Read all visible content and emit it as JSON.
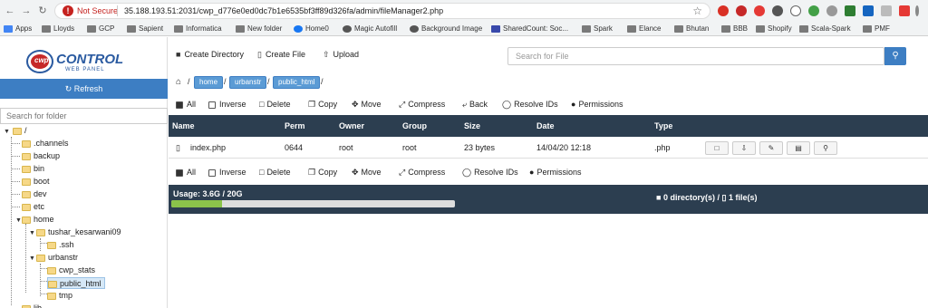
{
  "browser": {
    "security_label": "Not Secure",
    "url": "35.188.193.51:2031/cwp_d776e0ed0dc7b1e6535bf3ff89d326fa/admin/fileManager2.php",
    "bookmarks": [
      "Apps",
      "Lloyds",
      "GCP",
      "Sapient",
      "Informatica",
      "New folder",
      "Home0",
      "Magic Autofill",
      "Background Image",
      "SharedCount: Soc...",
      "Spark",
      "Elance",
      "Bhutan",
      "BBB",
      "Shopify",
      "Scala-Spark",
      "PMF"
    ]
  },
  "sidebar": {
    "logo_main": "CONTROL",
    "logo_sub": "WEB PANEL",
    "logo_prefix": "cwp",
    "refresh_label": "Refresh",
    "search_placeholder": "Search for folder",
    "tree": {
      "root": "/",
      "channels": ".channels",
      "backup": "backup",
      "bin": "bin",
      "boot": "boot",
      "dev": "dev",
      "etc": "etc",
      "home": "home",
      "tushar": "tushar_kesarwani09",
      "ssh": ".ssh",
      "urbanstr": "urbanstr",
      "cwp_stats": "cwp_stats",
      "public_html": "public_html",
      "tmp": "tmp",
      "lib": "lib"
    }
  },
  "toolbar": {
    "create_directory": "Create Directory",
    "create_file": "Create File",
    "upload": "Upload",
    "search_placeholder": "Search for File"
  },
  "breadcrumb": [
    "home",
    "urbanstr",
    "public_html"
  ],
  "actions": {
    "all": "All",
    "inverse": "Inverse",
    "delete": "Delete",
    "copy": "Copy",
    "move": "Move",
    "compress": "Compress",
    "back": "Back",
    "resolve_ids": "Resolve IDs",
    "permissions": "Permissions"
  },
  "table": {
    "columns": [
      "Name",
      "Perm",
      "Owner",
      "Group",
      "Size",
      "Date",
      "Type"
    ],
    "rows": [
      {
        "name": "index.php",
        "perm": "0644",
        "owner": "root",
        "group": "root",
        "size": "23 bytes",
        "date": "14/04/20 12:18",
        "type": ".php"
      }
    ]
  },
  "usage": {
    "label": "Usage: 3.6G / 20G",
    "fraction": 0.18,
    "dirs": "0 directory(s) /",
    "files": "1 file(s)"
  },
  "colors": {
    "accent": "#3d7ec3",
    "header": "#2c3e50",
    "usage_fill": "#8bc34a"
  }
}
